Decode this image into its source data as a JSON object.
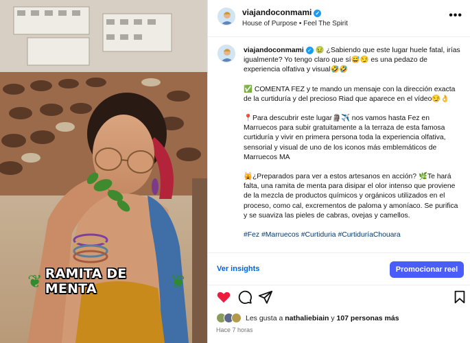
{
  "media": {
    "overlay_text": "RAMITA DE MENTA",
    "overlay_decoration": "mint-leaves"
  },
  "header": {
    "username": "viajandoconmami",
    "subtitle": "House of Purpose • Feel The Spirit",
    "more_icon": "more-dots-icon"
  },
  "caption": {
    "username": "viajandoconmami",
    "p1": "🤢 ¿Sabiendo que este lugar huele fatal, irías igualmente? Yo tengo claro que sí😅😏 es una pedazo de experiencia olfativa y visual🤣🤣",
    "p2": "✅ COMENTA FEZ y te mando un mensaje con la dirección exacta de la curtiduría y del precioso Riad que aparece en el vídeo😏👌",
    "p3": "📍Para descubrir este lugar🗿✈️ nos vamos hasta Fez en Marruecos para subir gratuitamente a la terraza de esta famosa curtiduría y vivir en primera persona toda la experiencia olfativa, sensorial y visual de uno de los iconos más emblemáticos de Marruecos MA",
    "p4": "🙀¿Preparados para ver a estos artesanos en acción? 🌿Te hará falta, una ramita de menta para disipar el olor intenso que proviene de la mezcla de productos químicos y orgánicos utilizados en el proceso, como cal, excrementos de paloma y amoníaco. Se purifica y se suaviza las pieles de  cabras, ovejas y camellos.",
    "hashtags": "#Fez #Marruecos #Curtiduria #CurtiduríaChouara"
  },
  "actions": {
    "insights_label": "Ver insights",
    "promote_label": "Promocionar reel",
    "icons": [
      "heart-icon",
      "comment-icon",
      "share-icon",
      "save-bookmark-icon"
    ],
    "heart_color": "#ed1c3c"
  },
  "likes": {
    "prefix": "Les gusta a ",
    "user": "nathaliebiain",
    "middle": " y ",
    "count": "107 personas más"
  },
  "time": "Hace 7 horas",
  "colors": {
    "accent": "#4a5df9",
    "link": "#0064e0",
    "hashtag": "#00376b",
    "verified": "#1d9bf0"
  }
}
